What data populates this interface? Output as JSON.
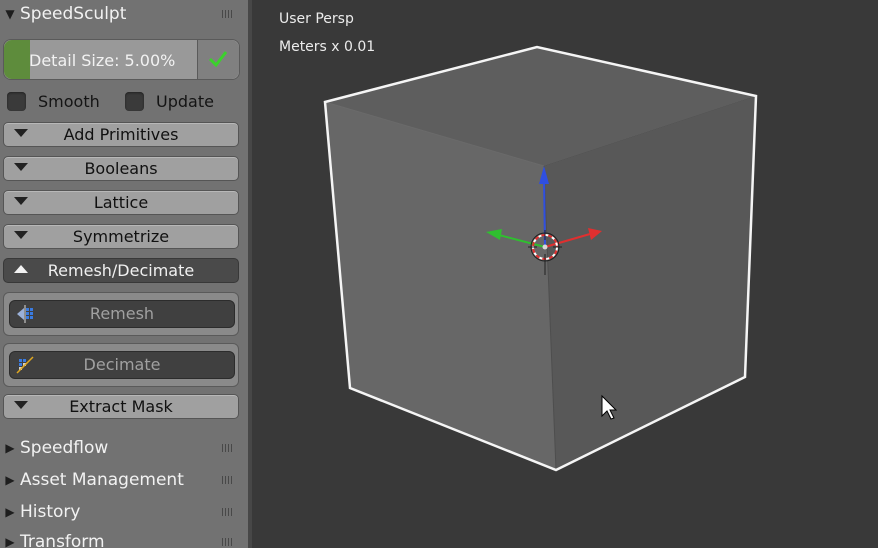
{
  "panel": {
    "speedsculpt_title": "SpeedSculpt",
    "detail_size_label": "Detail Size: 5.00%",
    "smooth_label": "Smooth",
    "update_label": "Update",
    "buttons": [
      {
        "label": "Add Primitives"
      },
      {
        "label": "Booleans"
      },
      {
        "label": "Lattice"
      },
      {
        "label": "Symmetrize"
      },
      {
        "label": "Remesh/Decimate"
      }
    ],
    "remesh_label": "Remesh",
    "decimate_label": "Decimate",
    "extract_mask_label": "Extract Mask",
    "sections": [
      {
        "label": "Speedflow"
      },
      {
        "label": "Asset Management"
      },
      {
        "label": "History"
      },
      {
        "label": "Transform"
      }
    ]
  },
  "viewport": {
    "view_name": "User Persp",
    "units": "Meters x 0.01"
  },
  "colors": {
    "panel_bg": "#727272",
    "viewport_bg": "#393939",
    "detail_fill": "#5e8c3c",
    "check_green": "#3bd12c"
  }
}
